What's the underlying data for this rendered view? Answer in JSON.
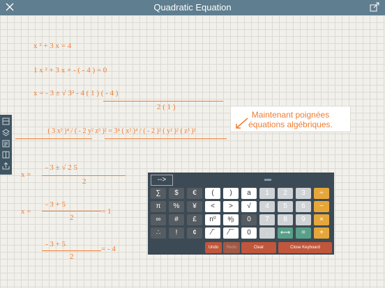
{
  "app": {
    "title": "Quadratic Equation"
  },
  "equations": {
    "e1": {
      "text": "x ² + 3 x = 4"
    },
    "e2": {
      "text": "1 x ² + 3 x + - ( - 4 ) = 0"
    },
    "e3": {
      "num": "x = - 3 ± √ 3² - 4 ( 1 ) ( - 4 )",
      "den": "2 ( 1 )"
    },
    "e4": {
      "text": "( 3 x² )⁴ / ( - 2 y² z³ )² = 3⁴ ( x² )⁴ / ( - 2 )² ( y² )² ( z³ )²"
    },
    "e5": {
      "num": "- 3 ± √ 2 5",
      "den": "2"
    },
    "e6": {
      "num": "- 3 + 5",
      "den": "2",
      "rhs": "= 1"
    },
    "e7": {
      "num": "- 3 + 5",
      "den": "2",
      "rhs": "= - 4"
    }
  },
  "tip": {
    "line1": "Maintenant poignées",
    "line2": "équations algébriques."
  },
  "keyboard": {
    "arrow": "-->",
    "rows": [
      [
        "∑",
        "$",
        "€",
        "(",
        ")",
        "a",
        "1",
        "2",
        "3",
        "÷"
      ],
      [
        "π",
        "%",
        "¥",
        "<",
        ">",
        "√",
        "4",
        "5",
        "6",
        "−"
      ],
      [
        "∞",
        "#",
        "£",
        "n⁰",
        "ᵃ⁄ᵦ",
        "0",
        "7",
        "8",
        "9",
        "×"
      ],
      [
        "∴",
        "!",
        "¢",
        "⁄‾",
        "⁄‾‾",
        "0",
        ".",
        "⟷",
        "=",
        "+"
      ]
    ],
    "undo": "Undo",
    "redo": "Redo",
    "clear": "Clear",
    "close": "Close Keyboard"
  }
}
